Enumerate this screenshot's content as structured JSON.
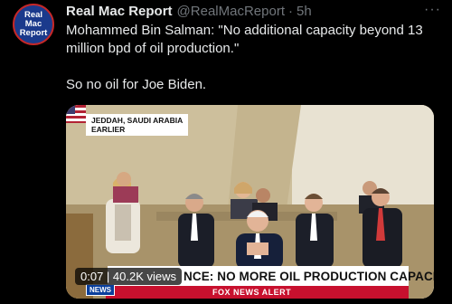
{
  "tweet": {
    "avatar": {
      "line1": "Real",
      "line2": "Mac",
      "line3": "Report"
    },
    "name": "Real Mac Report",
    "handle": "@RealMacReport",
    "separator": "·",
    "time": "5h",
    "more": "···",
    "text": {
      "para1": "Mohammed Bin Salman: \"No additional capacity beyond 13 million bpd of oil production.\"",
      "para2": "So no oil for Joe Biden."
    },
    "media": {
      "location_line1": "JEDDAH, SAUDI ARABIA",
      "location_line2": "EARLIER",
      "banner": "NCE: NO MORE OIL PRODUCTION CAPACITY",
      "lower_third": "FOX NEWS ALERT",
      "channel_bug": "NEWS",
      "timer": "0:07 | 40.2K views"
    }
  },
  "colors": {
    "background": "#000000",
    "text": "#e7e9ea",
    "muted": "#71767b",
    "alert_red": "#c8102e"
  }
}
